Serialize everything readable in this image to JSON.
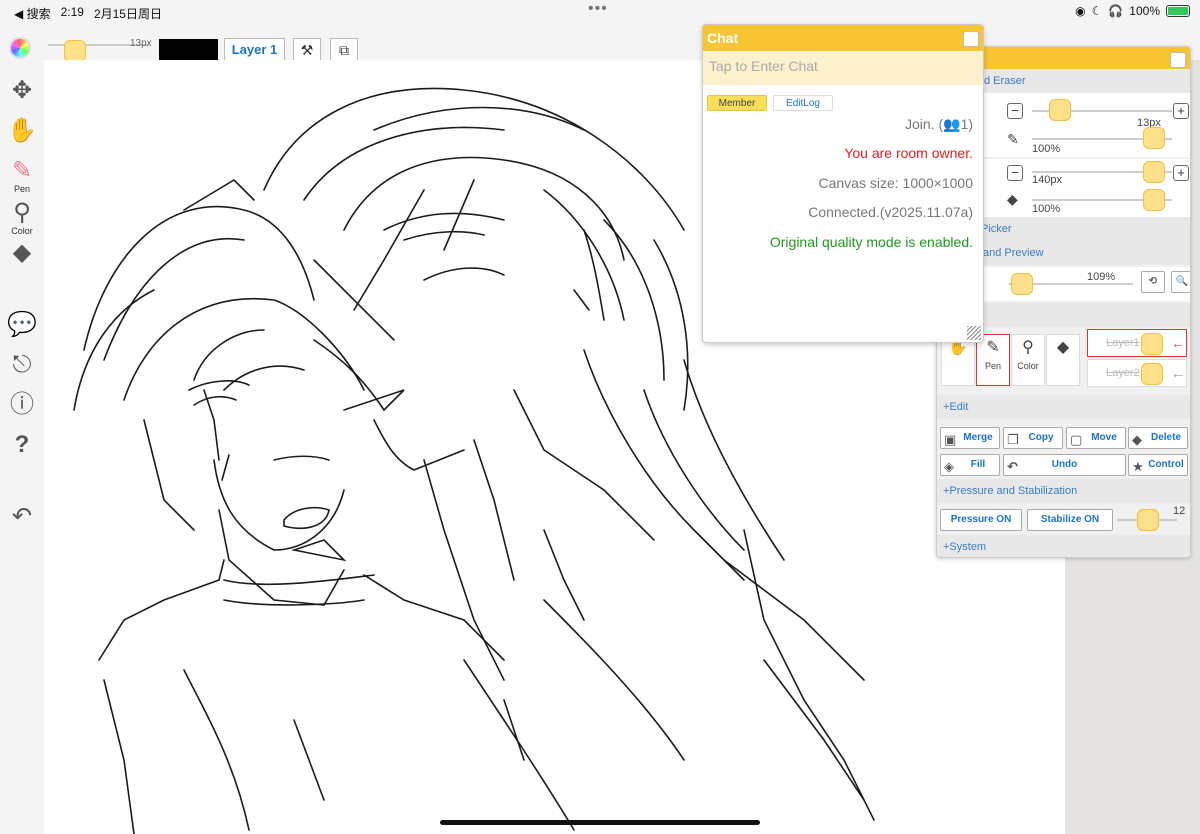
{
  "status_bar": {
    "back_label": "◀ 搜索",
    "time": "2:19",
    "date": "2月15日周日",
    "battery": "100%"
  },
  "topbar": {
    "brush_size": "13px",
    "layer_label": "Layer 1"
  },
  "leftbar": {
    "pen_label": "Pen",
    "color_label": "Color"
  },
  "chat": {
    "title": "Chat",
    "input_placeholder": "Tap to Enter Chat",
    "tabs": [
      "Member",
      "EditLog"
    ],
    "lines": [
      {
        "text": "Join. (👥1)",
        "color": "#777777"
      },
      {
        "text": "You are room owner.",
        "color": "#e02020"
      },
      {
        "text": "Canvas size: 1000×1000",
        "color": "#777777"
      },
      {
        "text": "Connected.(v2025.11.07a)",
        "color": "#777777"
      },
      {
        "text": "Original quality mode is enabled.",
        "color": "#1f9a1f"
      }
    ]
  },
  "toolpanel": {
    "section_pen_eraser": "f Pen and Eraser",
    "pen_size": "13px",
    "pen_opacity": "100%",
    "eraser_size": "140px",
    "eraser_opacity": "100%",
    "section_picker": "Picker",
    "section_preview": "and Preview",
    "zoom": "109%",
    "tools": [
      {
        "label": "",
        "icon": "hand-icon"
      },
      {
        "label": "Pen",
        "icon": "pen-icon"
      },
      {
        "label": "Color",
        "icon": "dropper-icon"
      },
      {
        "label": "",
        "icon": "eraser-icon"
      }
    ],
    "layers": [
      "Layer1",
      "Layer2"
    ],
    "section_edit": "+Edit",
    "edit_buttons": [
      "Merge",
      "Copy",
      "Move",
      "Delete"
    ],
    "fill_label": "Fill",
    "undo_label": "Undo",
    "control_label": "Control",
    "section_pressure": "+Pressure and Stabilization",
    "pressure_btn": "Pressure ON",
    "stabilize_btn": "Stabilize ON",
    "stabilize_value": "12",
    "section_system": "+System"
  },
  "colors": {
    "accent_yellow": "#f7c531",
    "link_blue": "#1a73c8",
    "owner_red": "#e02020",
    "ok_green": "#1f9a1f"
  }
}
